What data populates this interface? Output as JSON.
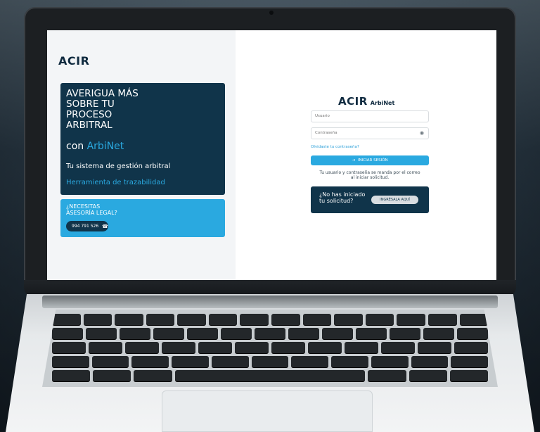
{
  "left": {
    "logo": "ACIR",
    "promo": {
      "title_lines": [
        "AVERIGUA MÁS",
        "SOBRE TU",
        "PROCESO",
        "ARBITRAL"
      ],
      "con_prefix": "con",
      "con_accent": "ArbiNet",
      "subtitle": "Tu sistema de gestión arbitral",
      "link": "Herramienta de trazabilidad"
    },
    "help": {
      "title_lines": [
        "¿NECESITAS",
        "ASESORÍA LEGAL?"
      ],
      "phone": "994 791 526",
      "phone_icon": "phone-icon"
    }
  },
  "login": {
    "brand_logo": "ACIR",
    "brand_app": "ArbiNet",
    "username_placeholder": "Usuario",
    "password_placeholder": "Contraseña",
    "eye_icon": "eye-off-icon",
    "forgot": "Olvidaste tu contraseña?",
    "login_button": "INICIAR SESIÓN",
    "login_icon": "login-icon",
    "note_lines": [
      "Tu usuario y contraseña se manda por el correo",
      "al iniciar solicitud."
    ],
    "cta_text_lines": [
      "¿No has iniciado",
      "tu solicitud?"
    ],
    "cta_button": "INGRÉSALA AQUÍ"
  },
  "colors": {
    "navy": "#10344a",
    "accent": "#2aa9e0",
    "panel": "#f3f5f7"
  }
}
